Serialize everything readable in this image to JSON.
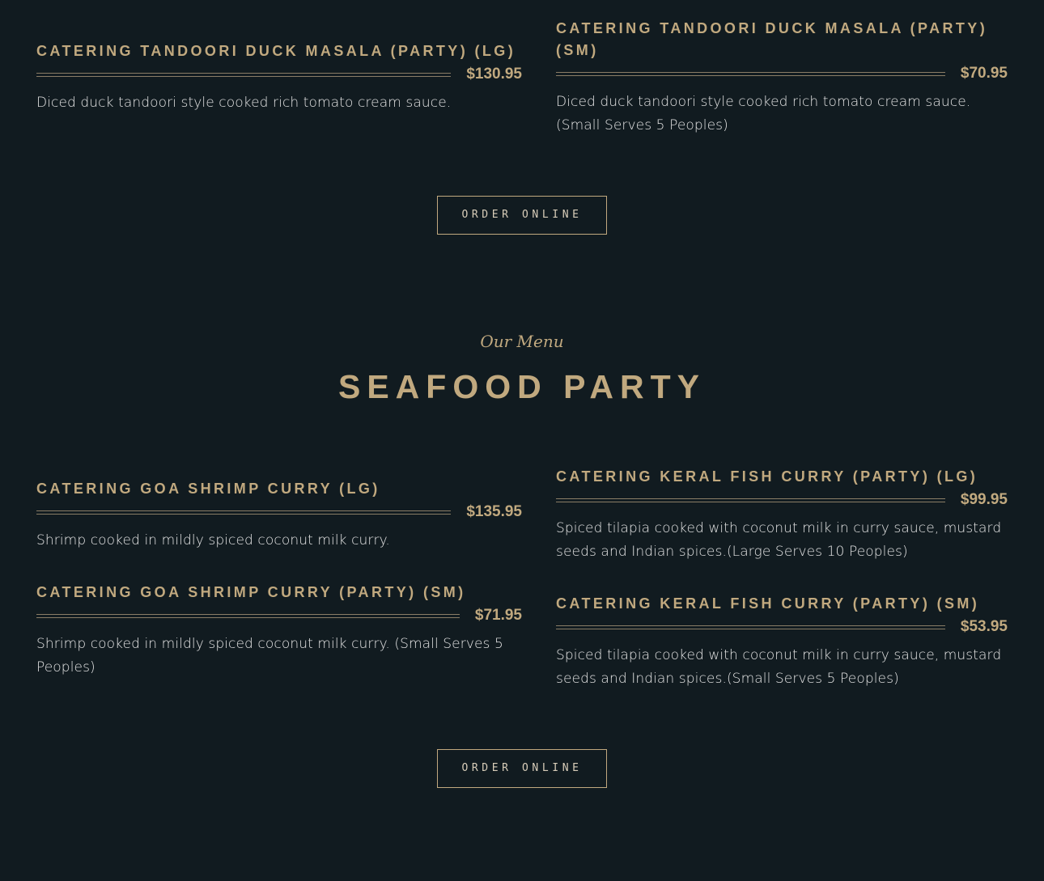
{
  "top_section": {
    "items_left": [
      {
        "title": "CATERING TANDOORI DUCK MASALA (PARTY) (LG)",
        "price": "$130.95",
        "description": "Diced duck tandoori style cooked rich tomato cream sauce."
      }
    ],
    "items_right": [
      {
        "title": "CATERING TANDOORI DUCK MASALA (PARTY) (SM)",
        "price": "$70.95",
        "description": "Diced duck tandoori style cooked rich tomato cream sauce. (Small Serves 5 Peoples)"
      }
    ],
    "order_button_label": "ORDER ONLINE"
  },
  "seafood_section": {
    "subtitle": "Our Menu",
    "title": "SEAFOOD PARTY",
    "items_left": [
      {
        "title": "CATERING GOA SHRIMP CURRY (LG)",
        "price": "$135.95",
        "description": "Shrimp cooked in mildly spiced coconut milk curry."
      },
      {
        "title": "CATERING GOA SHRIMP CURRY (PARTY) (SM)",
        "price": "$71.95",
        "description": "Shrimp cooked in mildly spiced coconut milk curry. (Small Serves 5 Peoples)"
      }
    ],
    "items_right": [
      {
        "title": "CATERING KERAL FISH CURRY (PARTY) (LG)",
        "price": "$99.95",
        "description": "Spiced tilapia cooked with coconut milk in curry sauce, mustard seeds and Indian spices.(Large Serves 10 Peoples)"
      },
      {
        "title": "CATERING KERAL FISH CURRY (PARTY) (SM)",
        "price": "$53.95",
        "description": "Spiced tilapia cooked with coconut milk in curry sauce, mustard seeds and Indian spices.(Small Serves 5 Peoples)"
      }
    ],
    "order_button_label": "ORDER ONLINE"
  },
  "colors": {
    "background": "#111b20",
    "accent_gold": "#c1a97f",
    "text_light": "#e4e4e4"
  }
}
